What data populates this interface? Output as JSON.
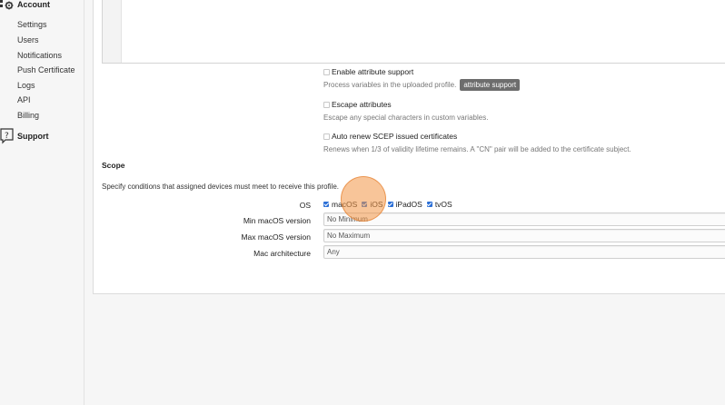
{
  "sidebar": {
    "account_heading": "Account",
    "items": [
      {
        "label": "Settings"
      },
      {
        "label": "Users"
      },
      {
        "label": "Notifications"
      },
      {
        "label": "Push Certificate"
      },
      {
        "label": "Logs"
      },
      {
        "label": "API"
      },
      {
        "label": "Billing"
      }
    ],
    "support_heading": "Support"
  },
  "options": {
    "attribute_support": {
      "label": "Enable attribute support",
      "desc": "Process variables in the uploaded profile.",
      "tag": "attribute support",
      "checked": false
    },
    "escape_attributes": {
      "label": "Escape attributes",
      "desc": "Escape any special characters in custom variables.",
      "checked": false
    },
    "auto_renew": {
      "label": "Auto renew SCEP issued certificates",
      "desc": "Renews when 1/3 of validity lifetime remains. A \"CN\" pair will be added to the certificate subject.",
      "checked": false
    }
  },
  "scope": {
    "title": "Scope",
    "description": "Specify conditions that assigned devices must meet to receive this profile.",
    "os_label": "OS",
    "os_options": [
      {
        "label": "macOS",
        "checked": true
      },
      {
        "label": "iOS",
        "checked": true
      },
      {
        "label": "iPadOS",
        "checked": true
      },
      {
        "label": "tvOS",
        "checked": true
      }
    ],
    "min_macos_label": "Min macOS version",
    "min_macos_value": "No Minimum",
    "max_macos_label": "Max macOS version",
    "max_macos_value": "No Maximum",
    "arch_label": "Mac architecture",
    "arch_value": "Any"
  },
  "colors": {
    "checkbox_accent": "#2b6fd6",
    "tag_bg": "#6d6d6d",
    "cursor_highlight": "#f29646"
  }
}
